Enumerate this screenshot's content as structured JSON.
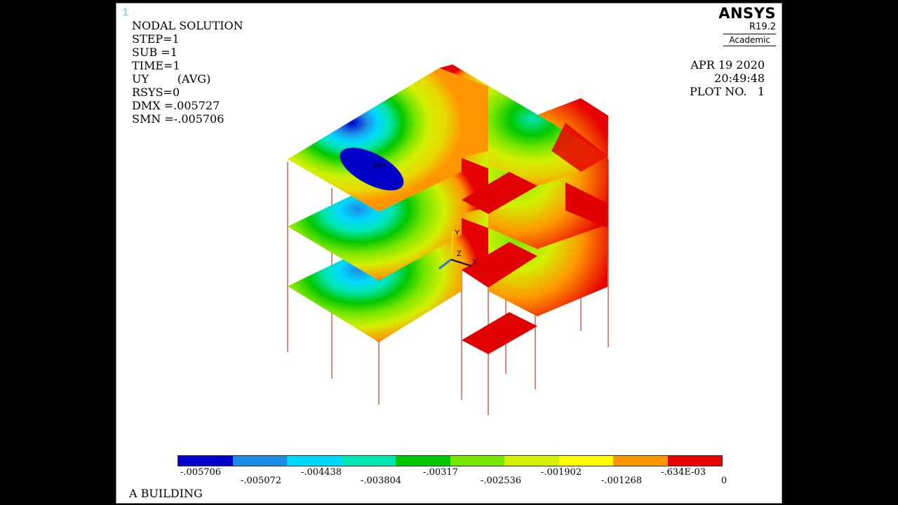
{
  "window": {
    "number": "1"
  },
  "info": {
    "lines": [
      "NODAL SOLUTION",
      "",
      "STEP=1",
      "SUB =1",
      "TIME=1",
      "UY        (AVG)",
      "RSYS=0",
      "DMX =.005727",
      "SMN =-.005706"
    ]
  },
  "brand": {
    "name": "ANSYS",
    "version": "R19.2",
    "edition": "Academic"
  },
  "datetime": {
    "date": "APR 19 2020",
    "time": "20:49:48",
    "plot": "PLOT NO.   1"
  },
  "title": "A BUILDING",
  "min_marker": "MN",
  "axes": {
    "x": "X",
    "y": "Y",
    "z": "Z"
  },
  "legend": {
    "colors": [
      "#0000c8",
      "#1e8ce6",
      "#00d7ff",
      "#00e6b4",
      "#00c800",
      "#78e600",
      "#d2f000",
      "#ffff00",
      "#ff9600",
      "#e60000"
    ],
    "labels_low": [
      "-.005706",
      "-.004438",
      "-.00317",
      "-.001902",
      "-.634E-03"
    ],
    "labels_high": [
      "-.005072",
      "-.003804",
      "-.002536",
      "-.001268",
      "0"
    ]
  }
}
